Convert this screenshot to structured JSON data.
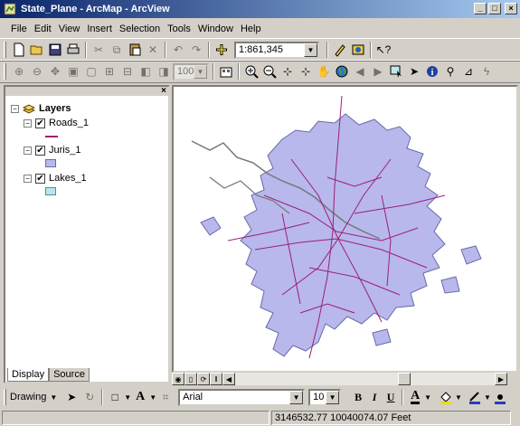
{
  "window": {
    "title": "State_Plane - ArcMap - ArcView"
  },
  "menu": [
    "File",
    "Edit",
    "View",
    "Insert",
    "Selection",
    "Tools",
    "Window",
    "Help"
  ],
  "scale": "1:861,345",
  "zoom_percent": "100%",
  "toc": {
    "root": "Layers",
    "layers": [
      {
        "name": "Roads_1",
        "checked": true,
        "symbol": "line",
        "color": "#9b1f7a"
      },
      {
        "name": "Juris_1",
        "checked": true,
        "symbol": "fill",
        "color": "#b8b8ec"
      },
      {
        "name": "Lakes_1",
        "checked": true,
        "symbol": "fill",
        "color": "#b7e6f0"
      }
    ],
    "tabs": [
      "Display",
      "Source"
    ]
  },
  "drawing": {
    "label": "Drawing",
    "font": "Arial",
    "size": "10",
    "bold": "B",
    "italic": "I",
    "underline": "U",
    "text_tool": "A"
  },
  "status": {
    "coordinates": "3146532.77  10040074.07 Feet"
  },
  "colors": {
    "juris_fill": "#b8b8ec",
    "roads": "#9b1f7a",
    "titlebar": "#0a246a"
  }
}
